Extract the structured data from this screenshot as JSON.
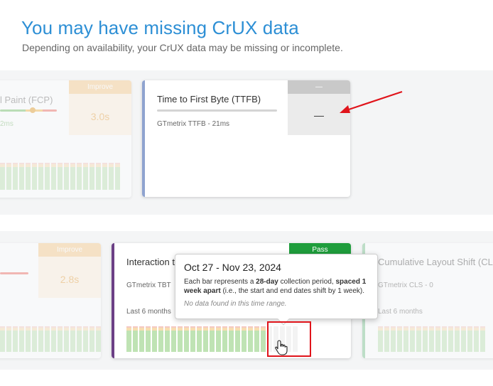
{
  "header": {
    "title": "You may have missing CrUX data",
    "subtitle": "Depending on availability, your CrUX data may be missing or incomplete."
  },
  "cards": {
    "fcp": {
      "title": "l Paint (FCP)",
      "grade_label": "Improve",
      "grade_value": "3.0s",
      "sub": "2ms"
    },
    "ttfb": {
      "title": "Time to First Byte (TTFB)",
      "grade_label": "—",
      "grade_value": "—",
      "sub": "GTmetrix TTFB - 21ms"
    },
    "left2": {
      "grade_label": "Improve",
      "grade_value": "2.8s"
    },
    "inp": {
      "title": "Interaction t",
      "grade_label": "Pass",
      "sub": "GTmetrix TBT",
      "range": "Last 6 months"
    },
    "cls": {
      "title": "Cumulative Layout Shift (CLS",
      "sub": "GTmetrix CLS - 0",
      "range": "Last 6 months"
    }
  },
  "tooltip": {
    "title": "Oct 27 - Nov 23, 2024",
    "body_1": "Each bar represents a ",
    "body_bold_1": "28-day",
    "body_2": " collection period, ",
    "body_bold_2": "spaced 1 week apart",
    "body_3": " (i.e., the start and end dates shift by 1 week).",
    "note": "No data found in this time range."
  },
  "colors": {
    "accent_blue": "#2d8fd5",
    "improve": "#f5b342",
    "pass": "#1f9d3c",
    "no_data": "#c9c9c9",
    "ttfb_accent": "#8fa3cf",
    "inp_accent": "#6b3f85",
    "annotation_red": "#e0141b"
  },
  "icons": {
    "cursor": "hand-pointer-icon",
    "annotation": "red-arrow-icon"
  }
}
